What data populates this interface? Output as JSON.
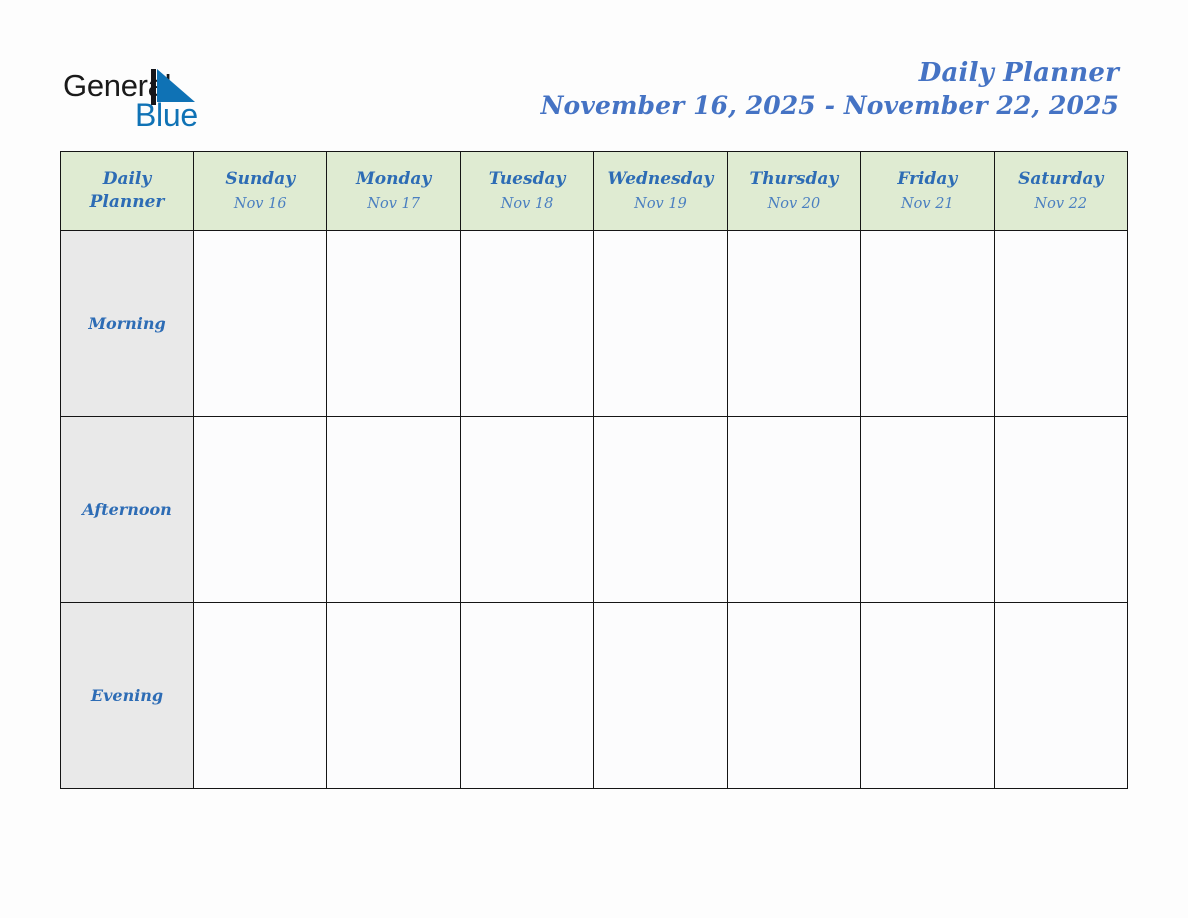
{
  "brand": {
    "name_dark": "General",
    "name_blue": "Blue",
    "logo_icon": "sail-triangle-icon",
    "blue": "#0f72b5",
    "dark": "#15151a"
  },
  "header": {
    "title": "Daily Planner",
    "date_range": "November 16, 2025 - November 22, 2025"
  },
  "palette": {
    "header_green": "#dfebd2",
    "period_gray": "#e9e9e9",
    "cell_white": "#fcfcfd",
    "text_blue_bold": "#2d6cb5",
    "text_blue_light": "#4a7fc0",
    "title_blue": "#4573c4",
    "border": "#151515",
    "page_background": "#fdfdfd"
  },
  "table": {
    "corner": {
      "line1": "Daily",
      "line2": "Planner"
    },
    "columns": [
      {
        "day": "Sunday",
        "date": "Nov 16"
      },
      {
        "day": "Monday",
        "date": "Nov 17"
      },
      {
        "day": "Tuesday",
        "date": "Nov 18"
      },
      {
        "day": "Wednesday",
        "date": "Nov 19"
      },
      {
        "day": "Thursday",
        "date": "Nov 20"
      },
      {
        "day": "Friday",
        "date": "Nov 21"
      },
      {
        "day": "Saturday",
        "date": "Nov 22"
      }
    ],
    "rows": [
      {
        "period": "Morning",
        "entries": [
          "",
          "",
          "",
          "",
          "",
          "",
          ""
        ]
      },
      {
        "period": "Afternoon",
        "entries": [
          "",
          "",
          "",
          "",
          "",
          "",
          ""
        ]
      },
      {
        "period": "Evening",
        "entries": [
          "",
          "",
          "",
          "",
          "",
          "",
          ""
        ]
      }
    ]
  }
}
